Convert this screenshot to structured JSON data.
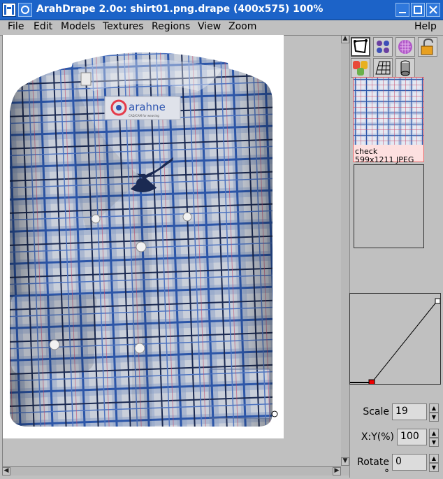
{
  "window": {
    "title": "ArahDrape 2.0o: shirt01.png.drape (400x575) 100%",
    "controls": [
      "minimize-icon",
      "maximize-icon",
      "close-icon"
    ]
  },
  "menubar": {
    "file": "File",
    "edit": "Edit",
    "models": "Models",
    "textures": "Textures",
    "regions": "Regions",
    "view": "View",
    "zoom": "Zoom",
    "help": "Help"
  },
  "canvas": {
    "logo_text": "arahne",
    "logo_subtext": "CAD/CAM for weaving",
    "colors": {
      "fabric_base": "#b8c4d8",
      "check_blue": "#2c56a8",
      "check_dark": "#1b2a52",
      "logo_accent": "#e53b4a",
      "logo_blue": "#2e55b0"
    }
  },
  "toolbar": {
    "row1": [
      "warp-tool-icon",
      "grid-dots-icon",
      "pattern-ball-icon",
      "lock-icon"
    ],
    "row2": [
      "masks-icon",
      "grid-mesh-icon",
      "cylinder-icon"
    ]
  },
  "textures": [
    {
      "name": "check",
      "info": "599x1211 JPEG"
    },
    {
      "name": "",
      "info": ""
    }
  ],
  "params": {
    "scale_label": "Scale",
    "scale_value": "19",
    "xy_label": "X:Y(%)",
    "xy_value": "100",
    "rotate_label": "Rotate °",
    "rotate_value": "0"
  }
}
